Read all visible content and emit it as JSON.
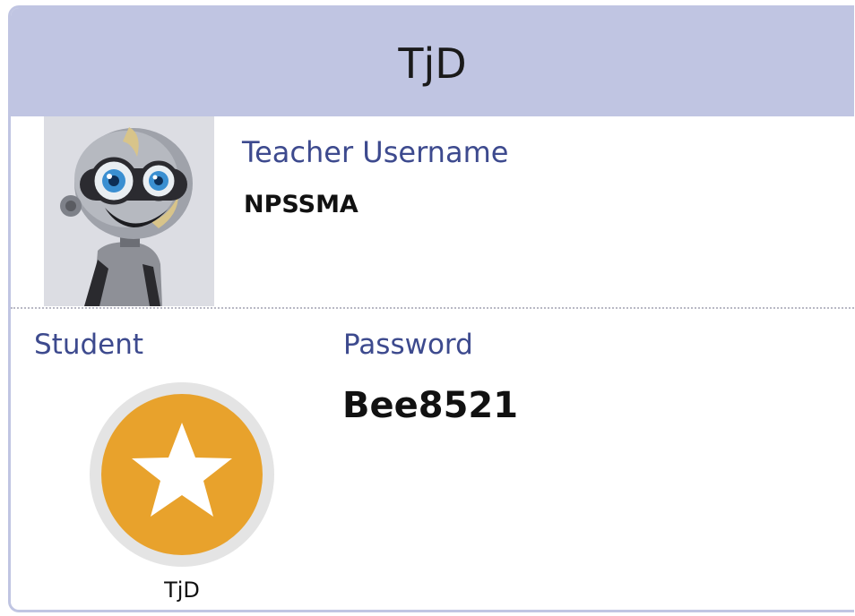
{
  "card": {
    "title": "TjD",
    "avatar_icon": "robot-avatar",
    "teacher": {
      "label": "Teacher Username",
      "value": "NPSSMA"
    },
    "student": {
      "label": "Student",
      "badge_icon": "star-icon",
      "name": "TjD"
    },
    "password": {
      "label": "Password",
      "value": "Bee8521"
    }
  },
  "colors": {
    "header_bg": "#c0c5e2",
    "label_text": "#3d4a8e",
    "badge_orange": "#e8a22c",
    "badge_ring": "#e4e4e4"
  }
}
